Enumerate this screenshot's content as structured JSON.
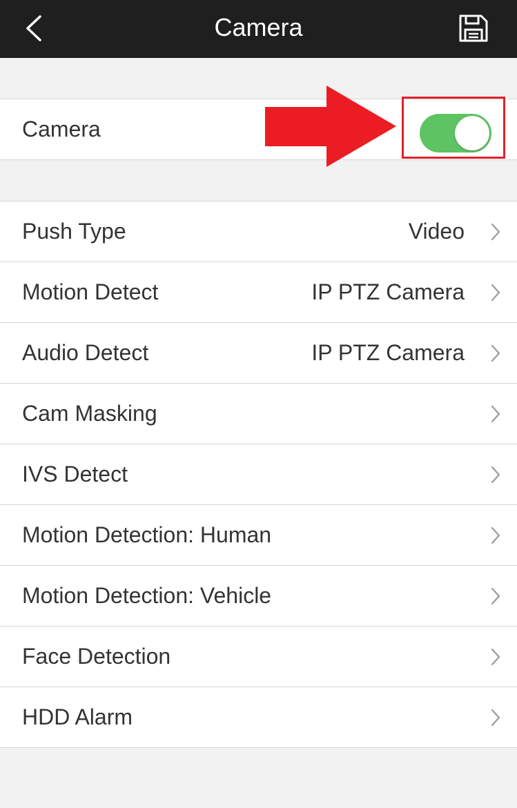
{
  "header": {
    "title": "Camera",
    "back_icon": "chevron-left-icon",
    "save_icon": "floppy-disk-icon",
    "background": "#1f1f1f"
  },
  "camera_toggle": {
    "label": "Camera",
    "enabled": true,
    "on_color": "#5ec463"
  },
  "annotation": {
    "arrow_color": "#ec1c24",
    "box_color": "#e3202b"
  },
  "settings": [
    {
      "label": "Push Type",
      "value": "Video"
    },
    {
      "label": "Motion Detect",
      "value": "IP PTZ Camera"
    },
    {
      "label": "Audio Detect",
      "value": "IP PTZ Camera"
    },
    {
      "label": "Cam Masking",
      "value": ""
    },
    {
      "label": "IVS Detect",
      "value": ""
    },
    {
      "label": "Motion Detection: Human",
      "value": ""
    },
    {
      "label": "Motion Detection: Vehicle",
      "value": ""
    },
    {
      "label": "Face Detection",
      "value": ""
    },
    {
      "label": "HDD Alarm",
      "value": ""
    }
  ]
}
